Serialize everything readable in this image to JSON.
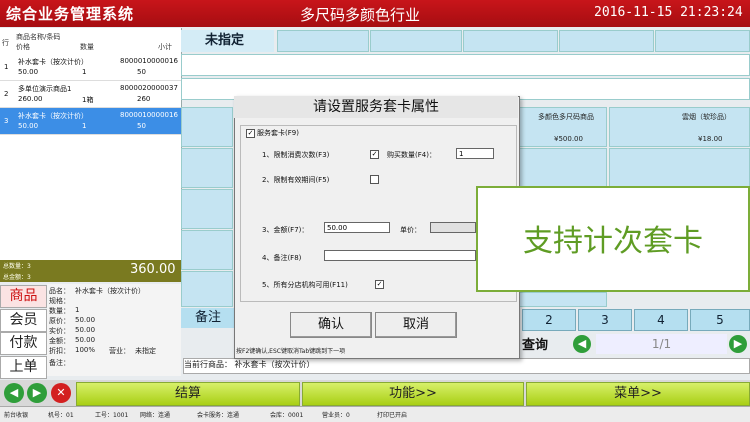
{
  "app_title": "综合业务管理系统",
  "page_title": "多尺码多颜色行业",
  "clock": "2016-11-15  21:23:24",
  "cart": {
    "headers": {
      "row": "行",
      "name": "商品名称/条码",
      "price": "价格",
      "qty": "数量",
      "subtotal": "小计"
    },
    "rows": [
      {
        "no": "1",
        "name": "补水套卡（按次计价）",
        "code": "8000010000016",
        "price": "50.00",
        "qty": "1",
        "subtotal": "50"
      },
      {
        "no": "2",
        "name": "多单位演示商品1",
        "code": "8000020000037",
        "price": "260.00",
        "qty": "1箱",
        "subtotal": "260"
      },
      {
        "no": "3",
        "name": "补水套卡（按次计价）",
        "code": "8000010000016",
        "price": "50.00",
        "qty": "1",
        "subtotal": "50"
      }
    ]
  },
  "summary": {
    "total_qty": "总数量：3",
    "total_amt": "总金额：3",
    "total": "360.00"
  },
  "side_buttons": {
    "product": "商品",
    "member": "会员",
    "payment": "付款",
    "up": "上单"
  },
  "detail": {
    "name_lbl": "品名：",
    "name": "补水套卡（按次计价）",
    "spec_lbl": "规格：",
    "qty_lbl": "数量：",
    "qty": "1",
    "orig_lbl": "原价：",
    "orig": "50.00",
    "actual_lbl": "实价：",
    "actual": "50.00",
    "amount_lbl": "金额：",
    "amount": "50.00",
    "disc_lbl": "折扣：",
    "disc": "100%",
    "sales_lbl": "营业：",
    "sales": "未指定",
    "remark_lbl": "备注："
  },
  "grid": {
    "unassigned": "未指定",
    "products": [
      {
        "name": "多颜色多尺码商品",
        "price": "¥500.00"
      },
      {
        "name": "雲烟（软珍品）",
        "price": "¥18.00"
      }
    ],
    "numbers": [
      "2",
      "3",
      "4",
      "5"
    ],
    "remark_label": "备注",
    "search_label": "查询",
    "pager": "1/1"
  },
  "current_item": "当前行商品：  补水套卡（按次计价）",
  "actions": {
    "checkout": "结算",
    "function": "功能>>",
    "menu": "菜单>>"
  },
  "status": {
    "app": "前台收银",
    "machine": "机号：01",
    "worker": "工号：1001",
    "network": "网络：连通",
    "member_service": "会卡服务：连通",
    "member_count": "会库：0001",
    "sales": "营业员：0",
    "print": "打印已开启"
  },
  "dialog": {
    "title": "请设置服务套卡属性",
    "group_label": "服务套卡(F9)",
    "limit_count": "1、限制消费次数(F3)",
    "buy_qty": "购买数量(F4)：",
    "buy_qty_value": "1",
    "limit_period": "2、限制有效期间(F5)",
    "amount": "3、金额(F7)：",
    "amount_value": "50.00",
    "unit_price": "单价：",
    "remark": "4、备注(F8)",
    "all_branches": "5、所有分店机构可用(F11)",
    "ok": "确认",
    "cancel": "取消",
    "hint": "按F2键确认,ESC键取消Tab键跳到下一项"
  },
  "callout": "支持计次套卡"
}
